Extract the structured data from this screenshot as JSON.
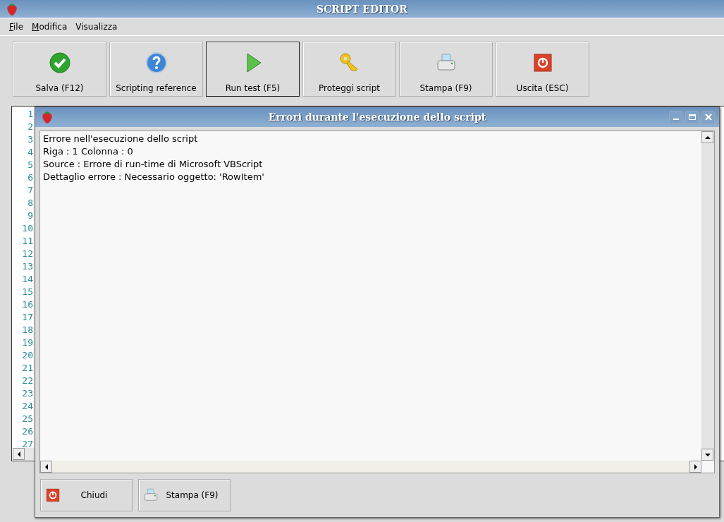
{
  "window": {
    "title": "SCRIPT EDITOR"
  },
  "menu": [
    {
      "mnemonic": "F",
      "rest": "ile"
    },
    {
      "mnemonic": "M",
      "rest": "odifica"
    },
    {
      "rest": "Visualizza"
    }
  ],
  "toolbar": [
    {
      "label": "Salva (F12)",
      "kind": "check",
      "focused": false
    },
    {
      "label": "Scripting reference",
      "kind": "help",
      "focused": false
    },
    {
      "label": "Run test (F5)",
      "kind": "play",
      "focused": true
    },
    {
      "label": "Proteggi script",
      "kind": "key",
      "focused": false
    },
    {
      "label": "Stampa (F9)",
      "kind": "printer",
      "focused": false
    },
    {
      "label": "Uscita (ESC)",
      "kind": "power",
      "focused": false
    }
  ],
  "editor": {
    "line_numbers": [
      "1",
      "2",
      "3",
      "4",
      "5",
      "6",
      "7",
      "8",
      "9",
      "10",
      "11",
      "12",
      "13",
      "14",
      "15",
      "16",
      "17",
      "18",
      "19",
      "20",
      "21",
      "22",
      "23",
      "24",
      "25",
      "26",
      "27"
    ]
  },
  "dialog": {
    "title": "Errori durante l'esecuzione dello script",
    "lines": [
      "Errore nell'esecuzione dello script",
      "Riga : 1   Colonna : 0",
      "Source : Errore di run-time di Microsoft VBScript",
      "Dettaglio errore : Necessario oggetto: 'RowItem'"
    ],
    "buttons": [
      {
        "label": "Chiudi",
        "kind": "power"
      },
      {
        "label": "Stampa (F9)",
        "kind": "printer"
      }
    ]
  }
}
